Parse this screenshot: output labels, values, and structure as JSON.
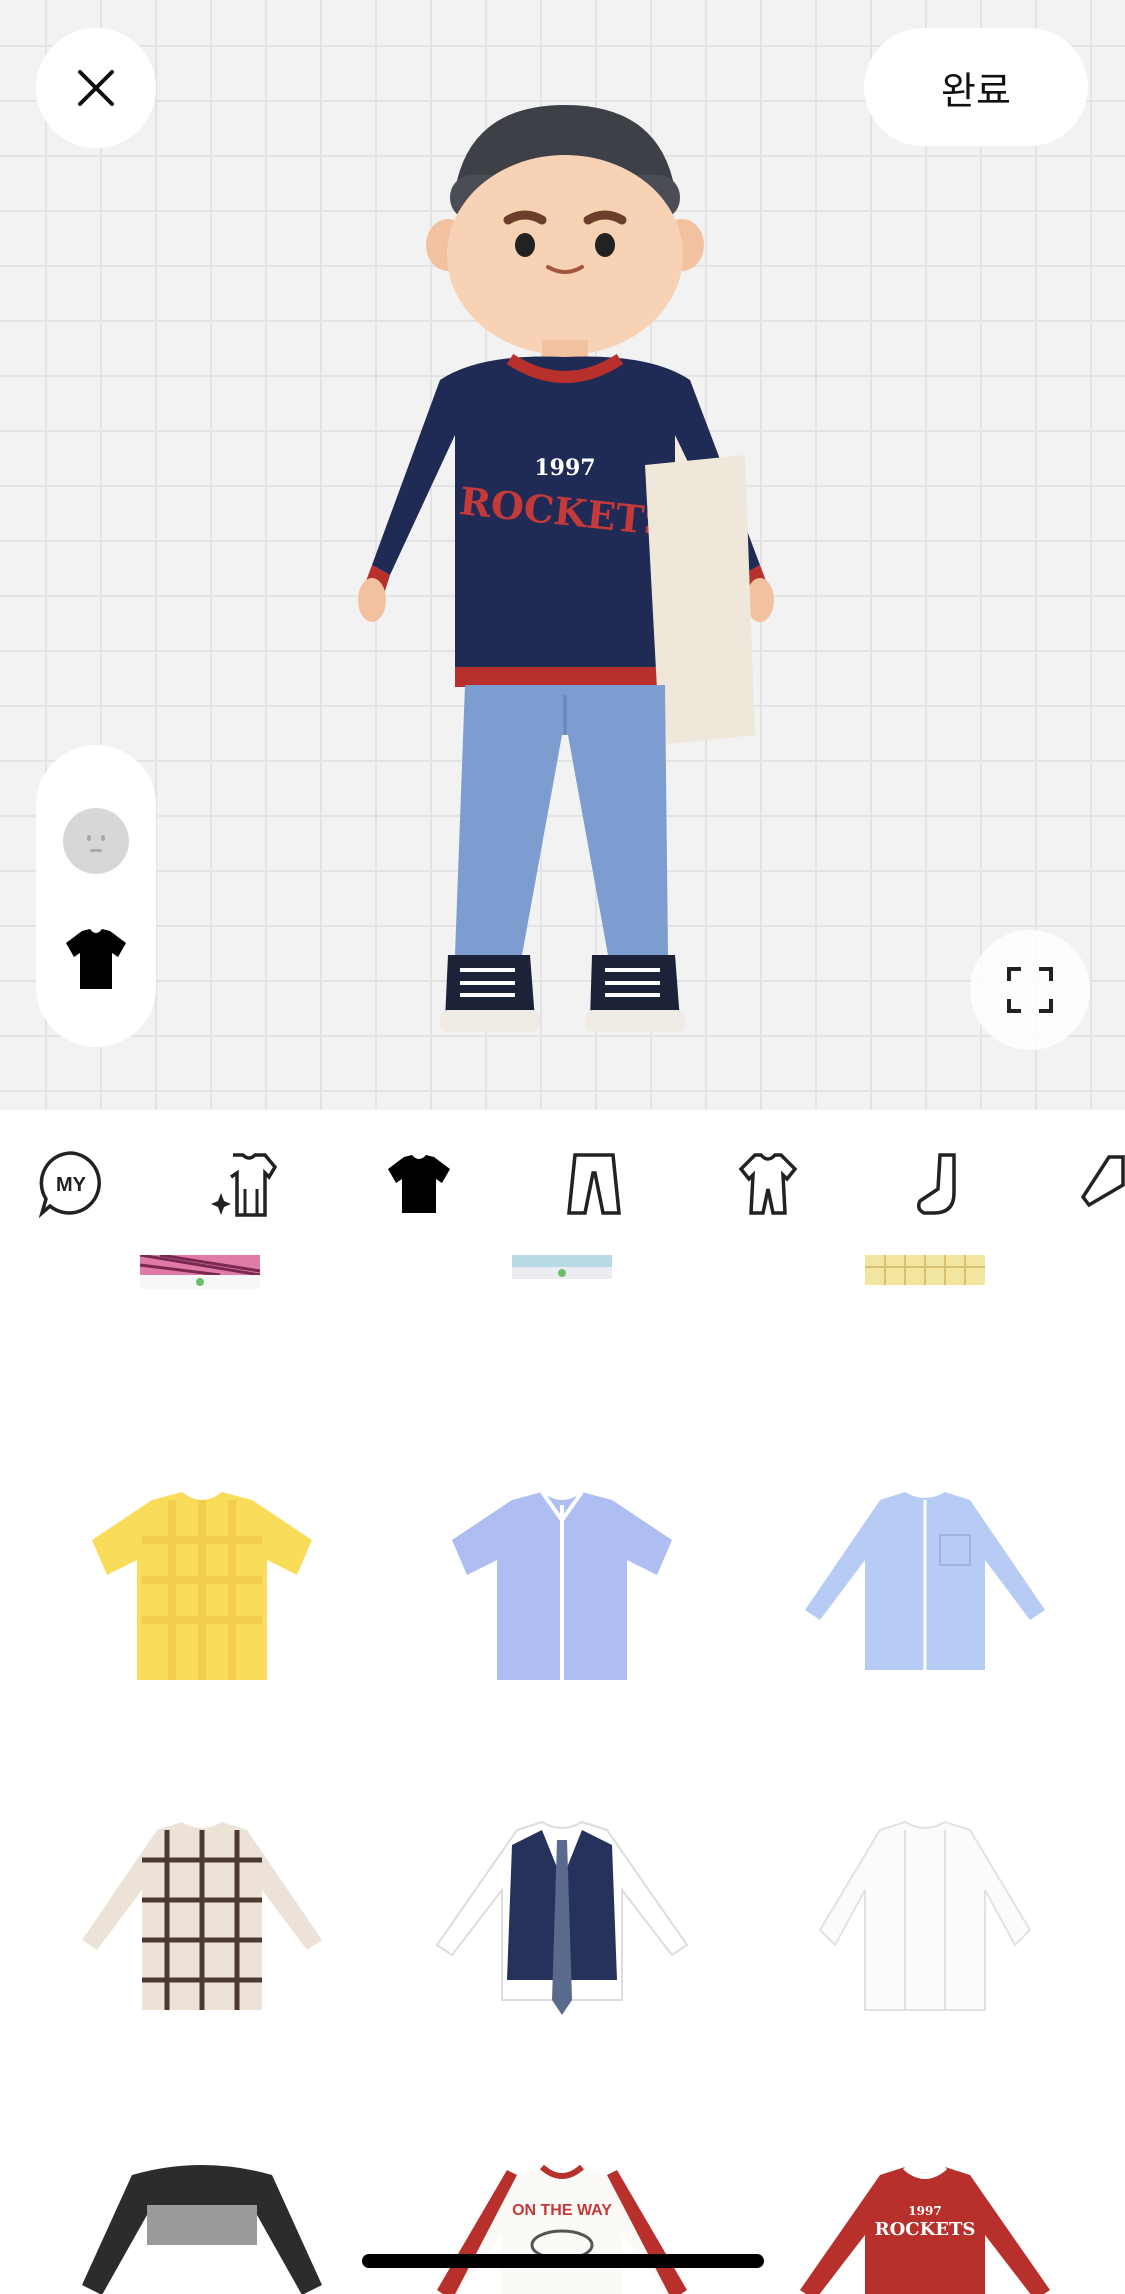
{
  "header": {
    "close_icon": "close-icon",
    "done_label": "완료"
  },
  "avatar": {
    "sweater_year": "1997",
    "sweater_text": "ROCKETS"
  },
  "side_toggle": {
    "items": [
      "face-icon",
      "shirt-icon"
    ],
    "selected": "shirt-icon"
  },
  "tabs": {
    "items": [
      {
        "icon": "my-icon",
        "label": "MY"
      },
      {
        "icon": "outfit-sparkle-icon"
      },
      {
        "icon": "tshirt-icon"
      },
      {
        "icon": "pants-icon"
      },
      {
        "icon": "onepiece-icon"
      },
      {
        "icon": "sock-icon"
      },
      {
        "icon": "shoe-icon"
      }
    ],
    "selected": "tshirt-icon"
  },
  "items": {
    "row2": [
      "yellow-check-shirt",
      "blue-short-sleeve-shirt",
      "blue-long-sleeve-shirt"
    ],
    "row3": [
      "plaid-long-sleeve-shirt",
      "vest-with-tie-shirt",
      "white-open-shirt"
    ],
    "row4_texts": {
      "middle": "ON THE WAY",
      "right_year": "1997",
      "right_text": "ROCKETS"
    }
  },
  "colors": {
    "stage_bg": "#f2f2f2",
    "navy": "#1f2a55",
    "red": "#b8302c",
    "jeans": "#7d9ccf"
  }
}
